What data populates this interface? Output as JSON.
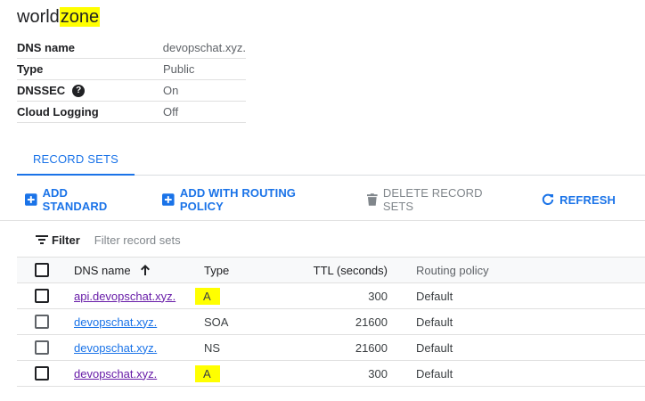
{
  "zone": {
    "title_plain": "world",
    "title_highlight": "zone"
  },
  "details": [
    {
      "key": "DNS name",
      "value": "devopschat.xyz."
    },
    {
      "key": "Type",
      "value": "Public"
    },
    {
      "key": "DNSSEC",
      "value": "On",
      "help_icon": "help-icon"
    },
    {
      "key": "Cloud Logging",
      "value": "Off"
    }
  ],
  "tabs": [
    {
      "label": "RECORD SETS",
      "active": true
    }
  ],
  "toolbar": {
    "add_standard": "ADD STANDARD",
    "add_routing": "ADD WITH ROUTING POLICY",
    "delete": "DELETE RECORD SETS",
    "refresh": "REFRESH"
  },
  "filter": {
    "label": "Filter",
    "placeholder": "Filter record sets"
  },
  "table": {
    "columns": {
      "dns_name": "DNS name",
      "type": "Type",
      "ttl": "TTL (seconds)",
      "routing": "Routing policy"
    },
    "sort": {
      "column": "dns_name",
      "direction": "ascending",
      "icon": "arrow-up-icon"
    },
    "rows": [
      {
        "dns_name": "api.devopschat.xyz.",
        "type": "A",
        "ttl": "300",
        "routing": "Default",
        "link_visited": true,
        "type_highlighted": true
      },
      {
        "dns_name": "devopschat.xyz.",
        "type": "SOA",
        "ttl": "21600",
        "routing": "Default",
        "link_visited": false,
        "type_highlighted": false
      },
      {
        "dns_name": "devopschat.xyz.",
        "type": "NS",
        "ttl": "21600",
        "routing": "Default",
        "link_visited": false,
        "type_highlighted": false
      },
      {
        "dns_name": "devopschat.xyz.",
        "type": "A",
        "ttl": "300",
        "routing": "Default",
        "link_visited": true,
        "type_highlighted": true
      }
    ]
  },
  "colors": {
    "accent": "#1a73e8",
    "visited_link": "#681da8",
    "highlight": "#ffff00",
    "disabled": "#80868b"
  }
}
